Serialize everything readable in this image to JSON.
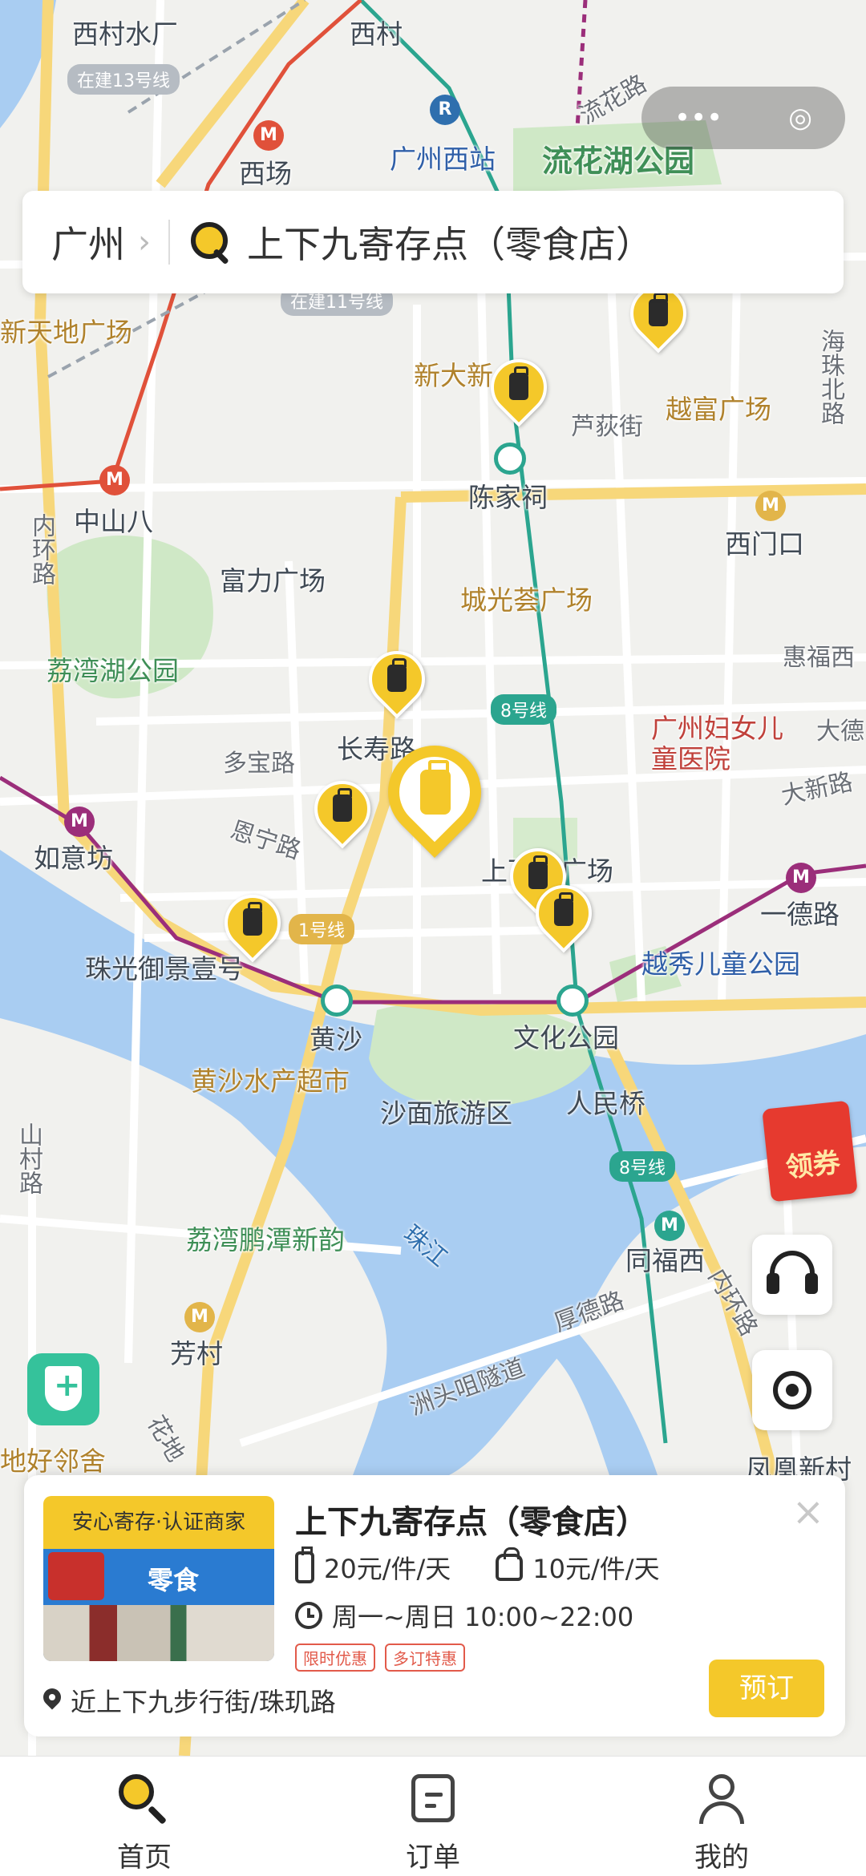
{
  "top_bar": {
    "capsule_more": "•••",
    "capsule_close": "◎"
  },
  "search": {
    "city": "广州",
    "query": "上下九寄存点（零食店）"
  },
  "map_labels": {
    "xicun_water": "西村水厂",
    "line13_building": "在建13号线",
    "xicun": "西村",
    "guangzhou_west": "广州西站",
    "liuhua_road": "流花路",
    "liuhua_park": "流花湖公园",
    "xichang": "西场",
    "line11_building": "在建11号线",
    "xintiandi": "新天地广场",
    "xindaxin": "新大新",
    "yuefu": "越富广场",
    "luodi_street": "芦荻街",
    "haizhu_north": "海珠北路",
    "zhongshan8": "中山八",
    "neihuan": "内环路",
    "chenjiaci": "陈家祠",
    "ximenkou": "西门口",
    "fuli": "富力广场",
    "chengguang": "城光荟广场",
    "huifu_west": "惠福西",
    "liwan_park": "荔湾湖公园",
    "line8_a": "8号线",
    "maternity": "广州妇女儿童医院",
    "dade": "大德",
    "changshou": "长寿路",
    "duobao": "多宝路",
    "enning": "恩宁路",
    "daxin": "大新路",
    "ruyifang": "如意坊",
    "shangxiajiu": "上下九广场",
    "yide": "一德路",
    "line1": "1号线",
    "zhuguang": "珠光御景壹号",
    "yuexiu_park": "越秀儿童公园",
    "huangsha": "黄沙",
    "wenhua_park": "文化公园",
    "huangsha_market": "黄沙水产超市",
    "shamian": "沙面旅游区",
    "renminqiao": "人民桥",
    "shancun": "山村路",
    "line8_b": "8号线",
    "pengtan": "荔湾鹏潭新韵",
    "pearl_river": "珠江",
    "tongfu_west": "同福西",
    "houde": "厚德路",
    "inner_ring": "内环路",
    "fangcun": "芳村",
    "zhoutou": "洲头咀隧道",
    "huadi": "花地",
    "haolin": "地好邻舍",
    "fenghuang": "凤凰新村"
  },
  "floating": {
    "coupon_label": "领券"
  },
  "store_card": {
    "badge": "安心寄存·认证商家",
    "photo_sign": "零食",
    "title": "上下九寄存点（零食店）",
    "close": "×",
    "price_luggage": "20元/件/天",
    "price_bag": "10元/件/天",
    "hours": "周一~周日 10:00~22:00",
    "promo1": "限时优惠",
    "promo2": "多订特惠",
    "address": "近上下九步行街/珠玑路",
    "book_button": "预订"
  },
  "tabbar": {
    "home": "首页",
    "orders": "订单",
    "me": "我的"
  },
  "colors": {
    "accent": "#f4c82a",
    "water": "#a9cdf2",
    "park": "#cfe8c6",
    "metro_teal": "#2ba58f",
    "metro_red": "#e0513a",
    "metro_purple": "#9b2e7a"
  }
}
